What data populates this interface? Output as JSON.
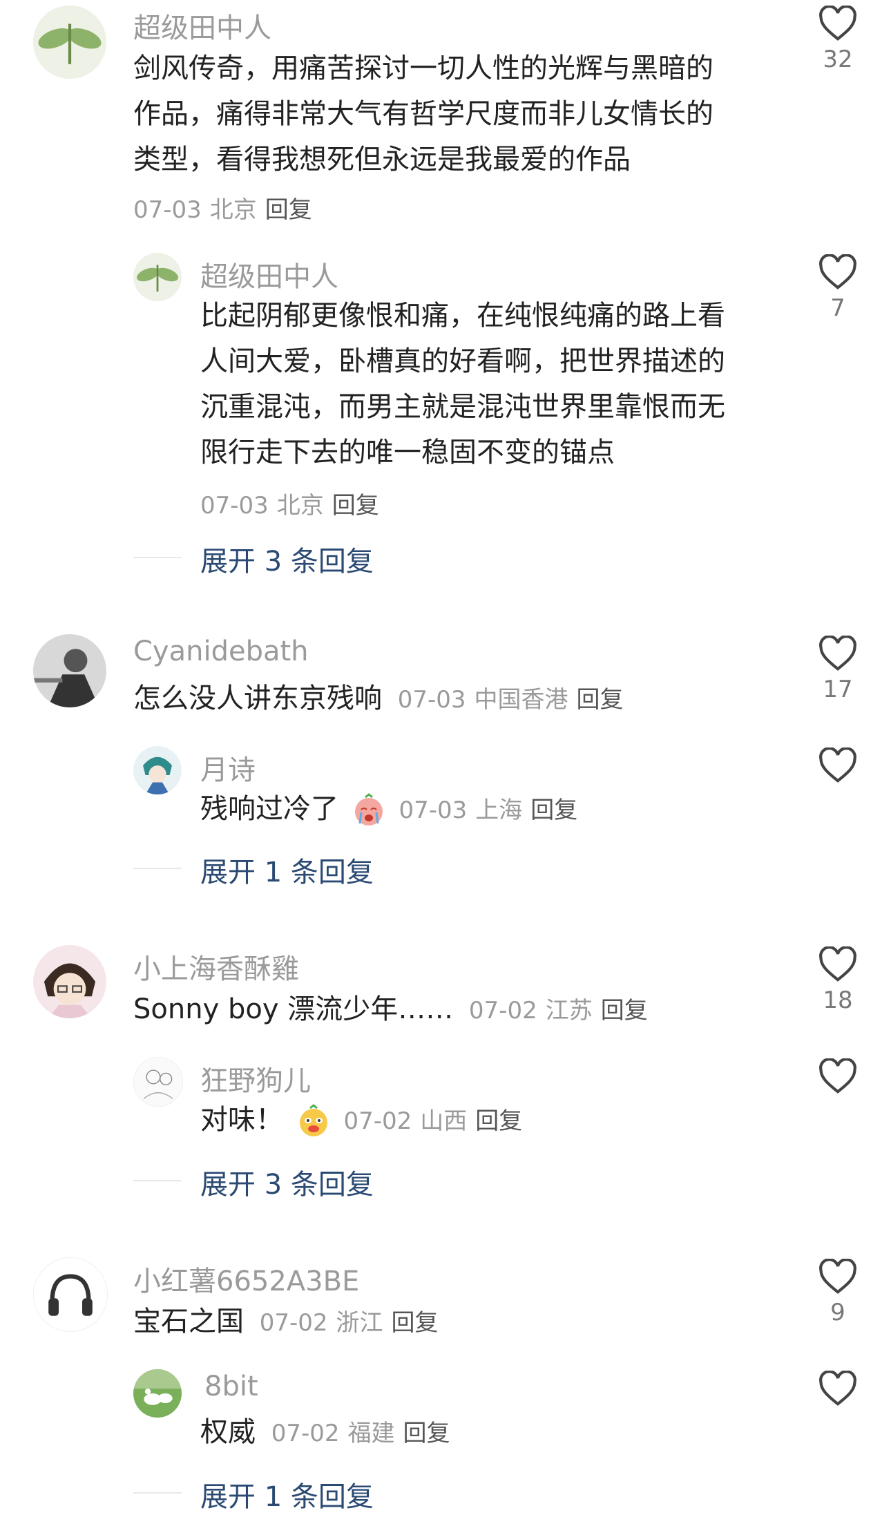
{
  "comments": [
    {
      "user": "超级田中人",
      "lines": [
        "剑风传奇，用痛苦探讨一切人性的光辉与黑暗的",
        "作品，痛得非常大气有哲学尺度而非儿女情长的",
        "类型，看得我想死但永远是我最爱的作品"
      ],
      "date": "07-03",
      "loc": "北京",
      "reply": "回复",
      "likes": "32",
      "sub": {
        "user": "超级田中人",
        "lines": [
          "比起阴郁更像恨和痛，在纯恨纯痛的路上看",
          "人间大爱，卧槽真的好看啊，把世界描述的",
          "沉重混沌，而男主就是混沌世界里靠恨而无",
          "限行走下去的唯一稳固不变的锚点"
        ],
        "date": "07-03",
        "loc": "北京",
        "reply": "回复",
        "likes": "7"
      },
      "expand": "展开 3 条回复"
    },
    {
      "user": "Cyanidebath",
      "text": "怎么没人讲东京残响",
      "date": "07-03",
      "loc": "中国香港",
      "reply": "回复",
      "likes": "17",
      "sub": {
        "user": "月诗",
        "text": "残响过冷了",
        "emoji": "crying-face-emoji",
        "date": "07-03",
        "loc": "上海",
        "reply": "回复",
        "likes": ""
      },
      "expand": "展开 1 条回复"
    },
    {
      "user": "小上海香酥雞",
      "text": "Sonny boy 漂流少年……",
      "date": "07-02",
      "loc": "江苏",
      "reply": "回复",
      "likes": "18",
      "sub": {
        "user": "狂野狗儿",
        "text": "对味！",
        "emoji": "smug-face-emoji",
        "date": "07-02",
        "loc": "山西",
        "reply": "回复",
        "likes": ""
      },
      "expand": "展开 3 条回复"
    },
    {
      "user": "小红薯6652A3BE",
      "text": "宝石之国",
      "date": "07-02",
      "loc": "浙江",
      "reply": "回复",
      "likes": "9",
      "sub": {
        "user": "8bit",
        "text": "权威",
        "date": "07-02",
        "loc": "福建",
        "reply": "回复",
        "likes": ""
      },
      "expand": "展开 1 条回复"
    }
  ],
  "icons": {
    "like": "heart-outline-icon"
  },
  "colors": {
    "name": "#9a9a9a",
    "expand": "#2b4a73"
  }
}
